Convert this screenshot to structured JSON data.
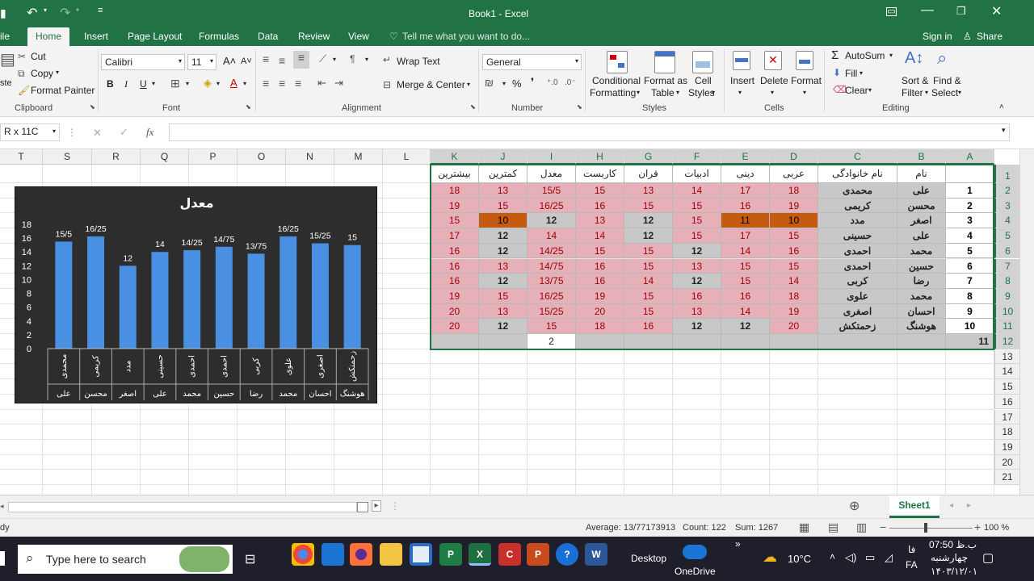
{
  "title": {
    "app": "Book1 - Excel"
  },
  "tabs": [
    "ile",
    "Home",
    "Insert",
    "Page Layout",
    "Formulas",
    "Data",
    "Review",
    "View"
  ],
  "tell_me": "Tell me what you want to do...",
  "account": {
    "signin": "Sign in",
    "share": "Share"
  },
  "clipboard": {
    "cut": "Cut",
    "copy": "Copy",
    "painter": "Format Painter",
    "paste": "ste",
    "group": "Clipboard"
  },
  "font": {
    "name": "Calibri",
    "size": "11",
    "group": "Font"
  },
  "alignment": {
    "wrap": "Wrap Text",
    "merge": "Merge & Center",
    "group": "Alignment"
  },
  "number": {
    "format": "General",
    "group": "Number"
  },
  "styles": {
    "cond1": "Conditional",
    "cond2": "Formatting",
    "fat1": "Format as",
    "fat2": "Table",
    "cs1": "Cell",
    "cs2": "Styles",
    "group": "Styles"
  },
  "cells": {
    "insert": "Insert",
    "delete": "Delete",
    "format": "Format",
    "group": "Cells"
  },
  "editing": {
    "autosum": "AutoSum",
    "fill": "Fill",
    "clear": "Clear",
    "sort1": "Sort &",
    "sort2": "Filter",
    "find1": "Find &",
    "find2": "Select",
    "group": "Editing"
  },
  "formula_bar": {
    "namebox": "R x 11C",
    "fx": "fx",
    "x": "✕",
    "check": "✓",
    "value": ""
  },
  "columns": [
    "T",
    "S",
    "R",
    "Q",
    "P",
    "O",
    "N",
    "M",
    "L",
    "K",
    "J",
    "I",
    "H",
    "G",
    "F",
    "E",
    "D",
    "C",
    "B",
    "A"
  ],
  "rows": [
    "1",
    "2",
    "3",
    "4",
    "5",
    "6",
    "7",
    "8",
    "9",
    "10",
    "11",
    "12",
    "13",
    "14",
    "15",
    "16",
    "17",
    "18",
    "19",
    "20",
    "21"
  ],
  "table": {
    "headers": [
      "بیشترین",
      "کمترین",
      "معدل",
      "کاربست",
      "قران",
      "ادبیات",
      "دینی",
      "عربی",
      "نام خانوادگی",
      "نام"
    ],
    "rows": [
      {
        "num": "1",
        "name": "علی",
        "family": "محمدی",
        "arabi": "18",
        "dini": "17",
        "adab": "14",
        "quran": "13",
        "karbast": "15",
        "avg": "15/5",
        "min": "13",
        "max": "18"
      },
      {
        "num": "2",
        "name": "محسن",
        "family": "کریمی",
        "arabi": "19",
        "dini": "16",
        "adab": "15",
        "quran": "15",
        "karbast": "16",
        "avg": "16/25",
        "min": "15",
        "max": "19"
      },
      {
        "num": "3",
        "name": "اصغر",
        "family": "مدد",
        "arabi": "10",
        "dini": "11",
        "adab": "15",
        "quran": "12",
        "karbast": "13",
        "avg": "12",
        "min": "10",
        "max": "15"
      },
      {
        "num": "4",
        "name": "علی",
        "family": "حسینی",
        "arabi": "15",
        "dini": "17",
        "adab": "15",
        "quran": "12",
        "karbast": "14",
        "avg": "14",
        "min": "12",
        "max": "17"
      },
      {
        "num": "5",
        "name": "محمد",
        "family": "احمدی",
        "arabi": "16",
        "dini": "14",
        "adab": "12",
        "quran": "15",
        "karbast": "15",
        "avg": "14/25",
        "min": "12",
        "max": "16"
      },
      {
        "num": "6",
        "name": "حسین",
        "family": "احمدی",
        "arabi": "15",
        "dini": "15",
        "adab": "13",
        "quran": "15",
        "karbast": "16",
        "avg": "14/75",
        "min": "13",
        "max": "16"
      },
      {
        "num": "7",
        "name": "رضا",
        "family": "کربی",
        "arabi": "14",
        "dini": "15",
        "adab": "12",
        "quran": "14",
        "karbast": "16",
        "avg": "13/75",
        "min": "12",
        "max": "16"
      },
      {
        "num": "8",
        "name": "محمد",
        "family": "علوی",
        "arabi": "18",
        "dini": "16",
        "adab": "16",
        "quran": "15",
        "karbast": "19",
        "avg": "16/25",
        "min": "15",
        "max": "19"
      },
      {
        "num": "9",
        "name": "احسان",
        "family": "اصغری",
        "arabi": "19",
        "dini": "14",
        "adab": "13",
        "quran": "15",
        "karbast": "20",
        "avg": "15/25",
        "min": "13",
        "max": "20"
      },
      {
        "num": "10",
        "name": "هوشنگ",
        "family": "زحمتکش",
        "arabi": "20",
        "dini": "12",
        "adab": "12",
        "quran": "16",
        "karbast": "18",
        "avg": "15",
        "min": "12",
        "max": "20"
      }
    ],
    "footer": {
      "num": "11",
      "i": "2"
    }
  },
  "chart_data": {
    "type": "bar",
    "title": "معدل",
    "categories": [
      "محمدی",
      "کریمی",
      "مدد",
      "حسینی",
      "احمدی",
      "احمدی",
      "کربی",
      "علوی",
      "اصغری",
      "زحمتکش"
    ],
    "categories2": [
      "علی",
      "محسن",
      "اصغر",
      "علی",
      "محمد",
      "حسین",
      "رضا",
      "محمد",
      "احسان",
      "هوشنگ"
    ],
    "values": [
      15.5,
      16.25,
      12,
      14,
      14.25,
      14.75,
      13.75,
      16.25,
      15.25,
      15
    ],
    "labels": [
      "15/5",
      "16/25",
      "12",
      "14",
      "14/25",
      "14/75",
      "13/75",
      "16/25",
      "15/25",
      "15"
    ],
    "yticks": [
      "0",
      "2",
      "4",
      "6",
      "8",
      "10",
      "12",
      "14",
      "16",
      "18"
    ],
    "ylim": [
      0,
      18
    ],
    "color": "#4a90e2",
    "grid": false,
    "legend": "none"
  },
  "sheet": {
    "tab": "Sheet1"
  },
  "status": {
    "ready": "dy",
    "average": "Average: 13/77173913",
    "count": "Count: 122",
    "sum": "Sum: 1267",
    "zoom": "100 %"
  },
  "taskbar": {
    "search": "Type here to search",
    "desktop": "Desktop",
    "onedrive": "OneDrive",
    "temp": "10°C",
    "lang": "FA",
    "lang2": "فا",
    "time": "07:50 ب.ظ",
    "day": "چهارشنبه",
    "date": "۱۴۰۳/۱۲/۰۱"
  }
}
